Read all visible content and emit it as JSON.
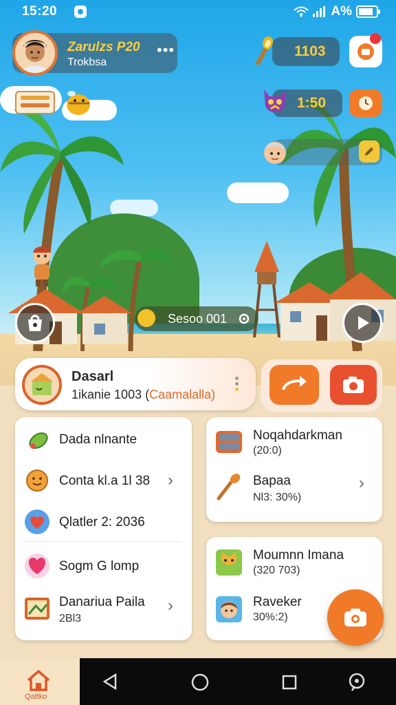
{
  "status": {
    "time": "15:20",
    "battery": "A%"
  },
  "player": {
    "name": "Zarulzs P20",
    "subtitle": "Trokbsa"
  },
  "resources": {
    "tokens": "1103",
    "timer": "1:50"
  },
  "location": {
    "label": "Sesoo 001"
  },
  "profile": {
    "title": "Dasarl",
    "subtitle_a": "1ikanie 1003 (",
    "subtitle_b": "Caamalalla)"
  },
  "left_card": {
    "items": [
      {
        "label": "Dada nlnante",
        "icon": "candy-icon"
      },
      {
        "label": "Conta kl.a 1l 38",
        "icon": "cookie-icon",
        "chevron": true
      },
      {
        "label": "Qlatler 2: 2036",
        "icon": "heart-icon"
      },
      {
        "label": "Sogm G lomp",
        "icon": "heart-pink-icon"
      },
      {
        "label": "Danariua Paila",
        "sub": "2Bl3",
        "icon": "picture-icon",
        "chevron": true
      }
    ]
  },
  "right_card_top": {
    "items": [
      {
        "label": "Noqahdarkman",
        "sub": "(20:0)",
        "icon": "chest-icon"
      },
      {
        "label": "Bapaa",
        "sub": "Nl3: 30%)",
        "icon": "torch-icon",
        "chevron": true
      }
    ]
  },
  "right_card_bottom": {
    "items": [
      {
        "label": "Moumnn Imana",
        "sub": "(320 703)",
        "icon": "cat-icon"
      },
      {
        "label": "Raveker",
        "sub": "30%:2)",
        "icon": "face-icon"
      }
    ]
  },
  "nav": {
    "home_label": "Qattko"
  },
  "colors": {
    "accent": "#f07a28",
    "camera": "#e8502f",
    "sky": "#2aa8ea"
  }
}
